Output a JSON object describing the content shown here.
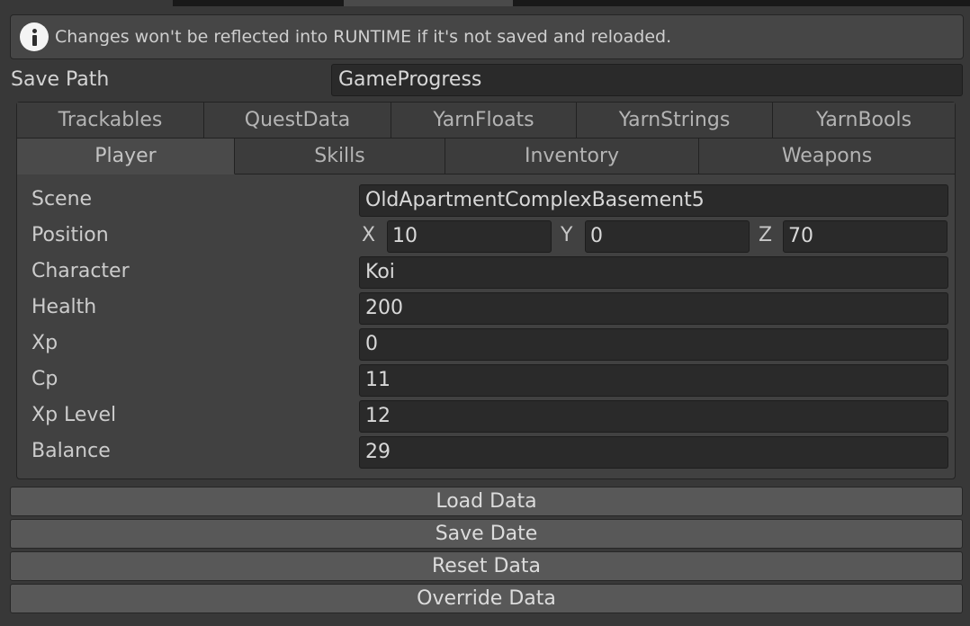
{
  "info": {
    "icon": "info-icon",
    "message": "Changes won't be reflected into RUNTIME if it's not saved and reloaded."
  },
  "save_path": {
    "label": "Save Path",
    "value": "GameProgress"
  },
  "tabs_row1": [
    "Trackables",
    "QuestData",
    "YarnFloats",
    "YarnStrings",
    "YarnBools"
  ],
  "tabs_row2": [
    "Player",
    "Skills",
    "Inventory",
    "Weapons"
  ],
  "active_tab": "Player",
  "player": {
    "scene": {
      "label": "Scene",
      "value": "OldApartmentComplexBasement5"
    },
    "position": {
      "label": "Position",
      "x_label": "X",
      "x": "10",
      "y_label": "Y",
      "y": "0",
      "z_label": "Z",
      "z": "70"
    },
    "character": {
      "label": "Character",
      "value": "Koi"
    },
    "health": {
      "label": "Health",
      "value": "200"
    },
    "xp": {
      "label": "Xp",
      "value": "0"
    },
    "cp": {
      "label": "Cp",
      "value": "11"
    },
    "xp_level": {
      "label": "Xp Level",
      "value": "12"
    },
    "balance": {
      "label": "Balance",
      "value": "29"
    }
  },
  "buttons": {
    "load": "Load Data",
    "save": "Save Date",
    "reset": "Reset Data",
    "override": "Override Data"
  }
}
